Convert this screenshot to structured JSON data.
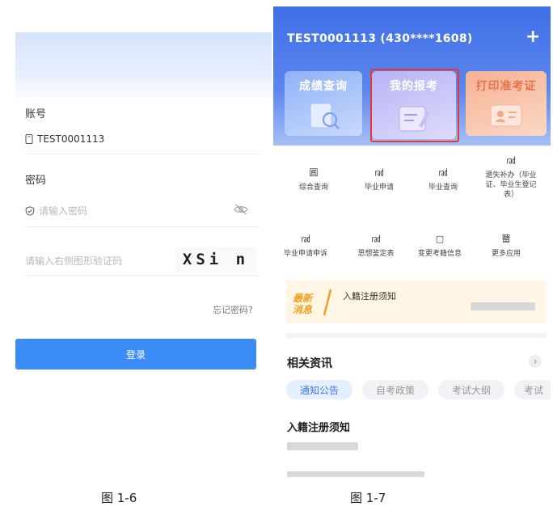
{
  "login": {
    "account_label": "账号",
    "account_value": "TEST0001113",
    "password_label": "密码",
    "password_placeholder": "请输入密码",
    "captcha_placeholder": "请输入右侧图形验证码",
    "captcha_text": "XSi n",
    "forgot_link": "忘记密码?",
    "login_button": "登录",
    "icons": {
      "account": "phone-icon",
      "password": "shield-icon",
      "toggle": "eye-off-icon"
    }
  },
  "home": {
    "account_title": "TEST0001113  (430****1608)",
    "add_button": "+",
    "cards": [
      {
        "label": "成绩查询",
        "color": "#ffffff"
      },
      {
        "label": "我的报考",
        "color": "#ffffff"
      },
      {
        "label": "打印准考证",
        "color": "#e8734a"
      }
    ],
    "grid": [
      {
        "icon": "囻",
        "label": "综合查询"
      },
      {
        "icon": "㎭",
        "label": "毕业申请"
      },
      {
        "icon": "㎭",
        "label": "毕业查询"
      },
      {
        "icon": "㎭",
        "label": "遗失补办（毕业证、毕业生登记表）"
      },
      {
        "icon": "㎭",
        "label": "毕业申请申诉"
      },
      {
        "icon": "㎭",
        "label": "思想鉴定表"
      },
      {
        "icon": "▢",
        "label": "变更考籍信息"
      },
      {
        "icon": "罶",
        "label": "更多应用"
      }
    ],
    "news": {
      "tag_line1": "最新",
      "tag_line2": "消息",
      "title": "入籍注册须知"
    },
    "related": {
      "title": "相关资讯",
      "more": "›",
      "tabs": [
        "通知公告",
        "自考政策",
        "考试大纲",
        "考试"
      ],
      "article_title": "入籍注册须知"
    },
    "highlight_color": "#e53935"
  },
  "captions": {
    "left": "图 1-6",
    "right": "图 1-7"
  }
}
